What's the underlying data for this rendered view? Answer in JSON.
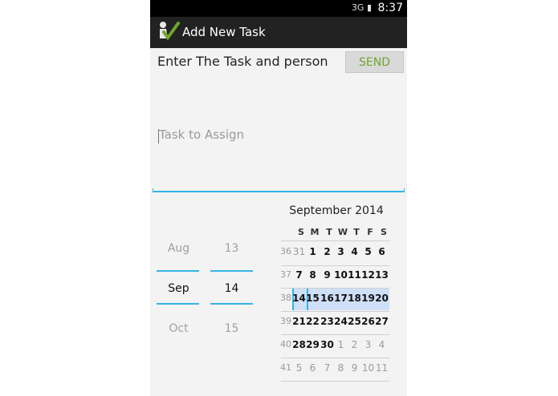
{
  "status": {
    "time": "8:37",
    "icons": "3G ▮"
  },
  "app": {
    "title": "Add New Task",
    "icon_color": "#6fa52c"
  },
  "form": {
    "prompt": "Enter The Task and person",
    "send_label": "SEND",
    "task_placeholder": "Task to Assign"
  },
  "date_picker": {
    "months": [
      "Aug",
      "Sep",
      "Oct"
    ],
    "days": [
      "13",
      "14",
      "15"
    ]
  },
  "calendar": {
    "title": "September 2014",
    "weekday_headers": [
      "S",
      "M",
      "T",
      "W",
      "T",
      "F",
      "S"
    ],
    "weeks": [
      {
        "week": "36",
        "days": [
          "31",
          "1",
          "2",
          "3",
          "4",
          "5",
          "6"
        ]
      },
      {
        "week": "37",
        "days": [
          "7",
          "8",
          "9",
          "10",
          "11",
          "12",
          "13"
        ]
      },
      {
        "week": "38",
        "days": [
          "14",
          "15",
          "16",
          "17",
          "18",
          "19",
          "20"
        ]
      },
      {
        "week": "39",
        "days": [
          "21",
          "22",
          "23",
          "24",
          "25",
          "26",
          "27"
        ]
      },
      {
        "week": "40",
        "days": [
          "28",
          "29",
          "30",
          "1",
          "2",
          "3",
          "4"
        ]
      },
      {
        "week": "41",
        "days": [
          "5",
          "6",
          "7",
          "8",
          "9",
          "10",
          "11"
        ]
      }
    ],
    "selected": "14",
    "accent_color": "#33b5e5",
    "selection_color": "#cfdff7"
  }
}
